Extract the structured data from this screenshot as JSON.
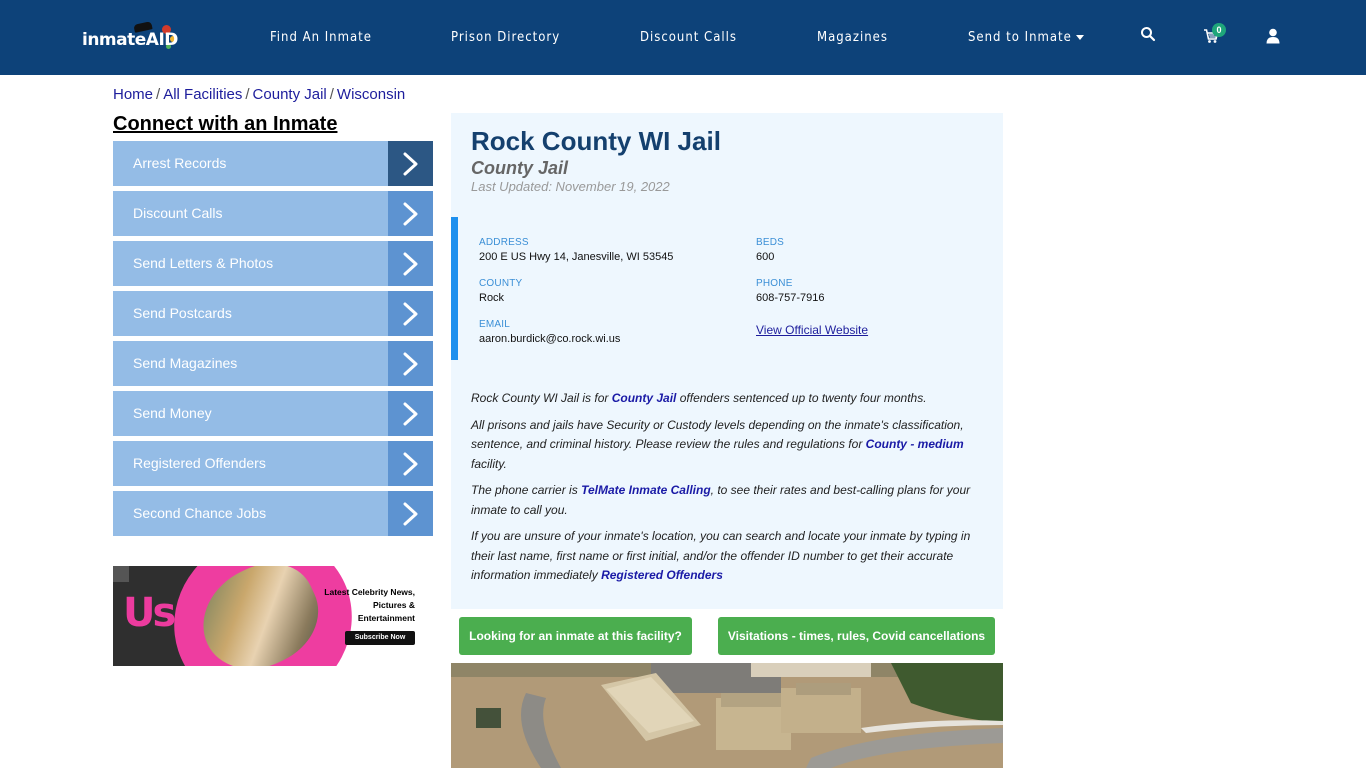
{
  "header": {
    "logo_text": "inmate",
    "logo_accent": "AID",
    "nav": [
      {
        "label": "Find An Inmate"
      },
      {
        "label": "Prison Directory"
      },
      {
        "label": "Discount Calls"
      },
      {
        "label": "Magazines"
      },
      {
        "label": "Send to Inmate",
        "has_dropdown": true
      }
    ],
    "icons": [
      "search-icon",
      "cart-icon",
      "user-icon"
    ],
    "cart_count": "0"
  },
  "breadcrumb": [
    {
      "label": "Home"
    },
    {
      "label": "All Facilities"
    },
    {
      "label": "County Jail"
    },
    {
      "label": "Wisconsin"
    }
  ],
  "breadcrumb_separator": "/",
  "sidebar": {
    "title": "Connect with an Inmate",
    "items": [
      {
        "label": "Arrest Records",
        "active": true
      },
      {
        "label": "Discount Calls"
      },
      {
        "label": "Send Letters & Photos"
      },
      {
        "label": "Send Postcards"
      },
      {
        "label": "Send Magazines"
      },
      {
        "label": "Send Money"
      },
      {
        "label": "Registered Offenders"
      },
      {
        "label": "Second Chance Jobs"
      }
    ],
    "ad": {
      "brand": "Us",
      "headline": "Latest Celebrity News, Pictures & Entertainment",
      "button": "Subscribe Now"
    }
  },
  "facility": {
    "name": "Rock County WI Jail",
    "type": "County Jail",
    "last_updated": "Last Updated: November 19, 2022",
    "fields": {
      "address_label": "ADDRESS",
      "address": "200 E US Hwy 14, Janesville, WI 53545",
      "county_label": "COUNTY",
      "county": "Rock",
      "email_label": "EMAIL",
      "email": "aaron.burdick@co.rock.wi.us",
      "beds_label": "BEDS",
      "beds": "600",
      "phone_label": "PHONE",
      "phone": "608-757-7916",
      "website_link": "View Official Website"
    },
    "description": {
      "p1_a": "Rock County WI Jail is for ",
      "p1_link": "County Jail",
      "p1_b": " offenders sentenced up to twenty four months.",
      "p2_a": "All prisons and jails have Security or Custody levels depending on the inmate's classification, sentence, and criminal history. Please review the rules and regulations for ",
      "p2_link": "County - medium",
      "p2_b": " facility.",
      "p3_a": "The phone carrier is ",
      "p3_link": "TelMate Inmate Calling",
      "p3_b": ", to see their rates and best-calling plans for your inmate to call you.",
      "p4_a": "If you are unsure of your inmate's location, you can search and locate your inmate by typing in their last name, first name or first initial, and/or the offender ID number to get their accurate information immediately ",
      "p4_link": "Registered Offenders"
    },
    "buttons": {
      "find_inmate": "Looking for an inmate at this facility?",
      "visitation": "Visitations - times, rules, Covid cancellations"
    }
  },
  "colors": {
    "header_bg": "#0d4279",
    "sidebar_item": "#94bce6",
    "sidebar_arrow": "#5d93d1",
    "sidebar_arrow_active": "#2c5784",
    "card_bg": "#eef7fe",
    "accent_bar": "#1e90ee",
    "green_button": "#4bae4f",
    "link": "#1a1aa6"
  }
}
